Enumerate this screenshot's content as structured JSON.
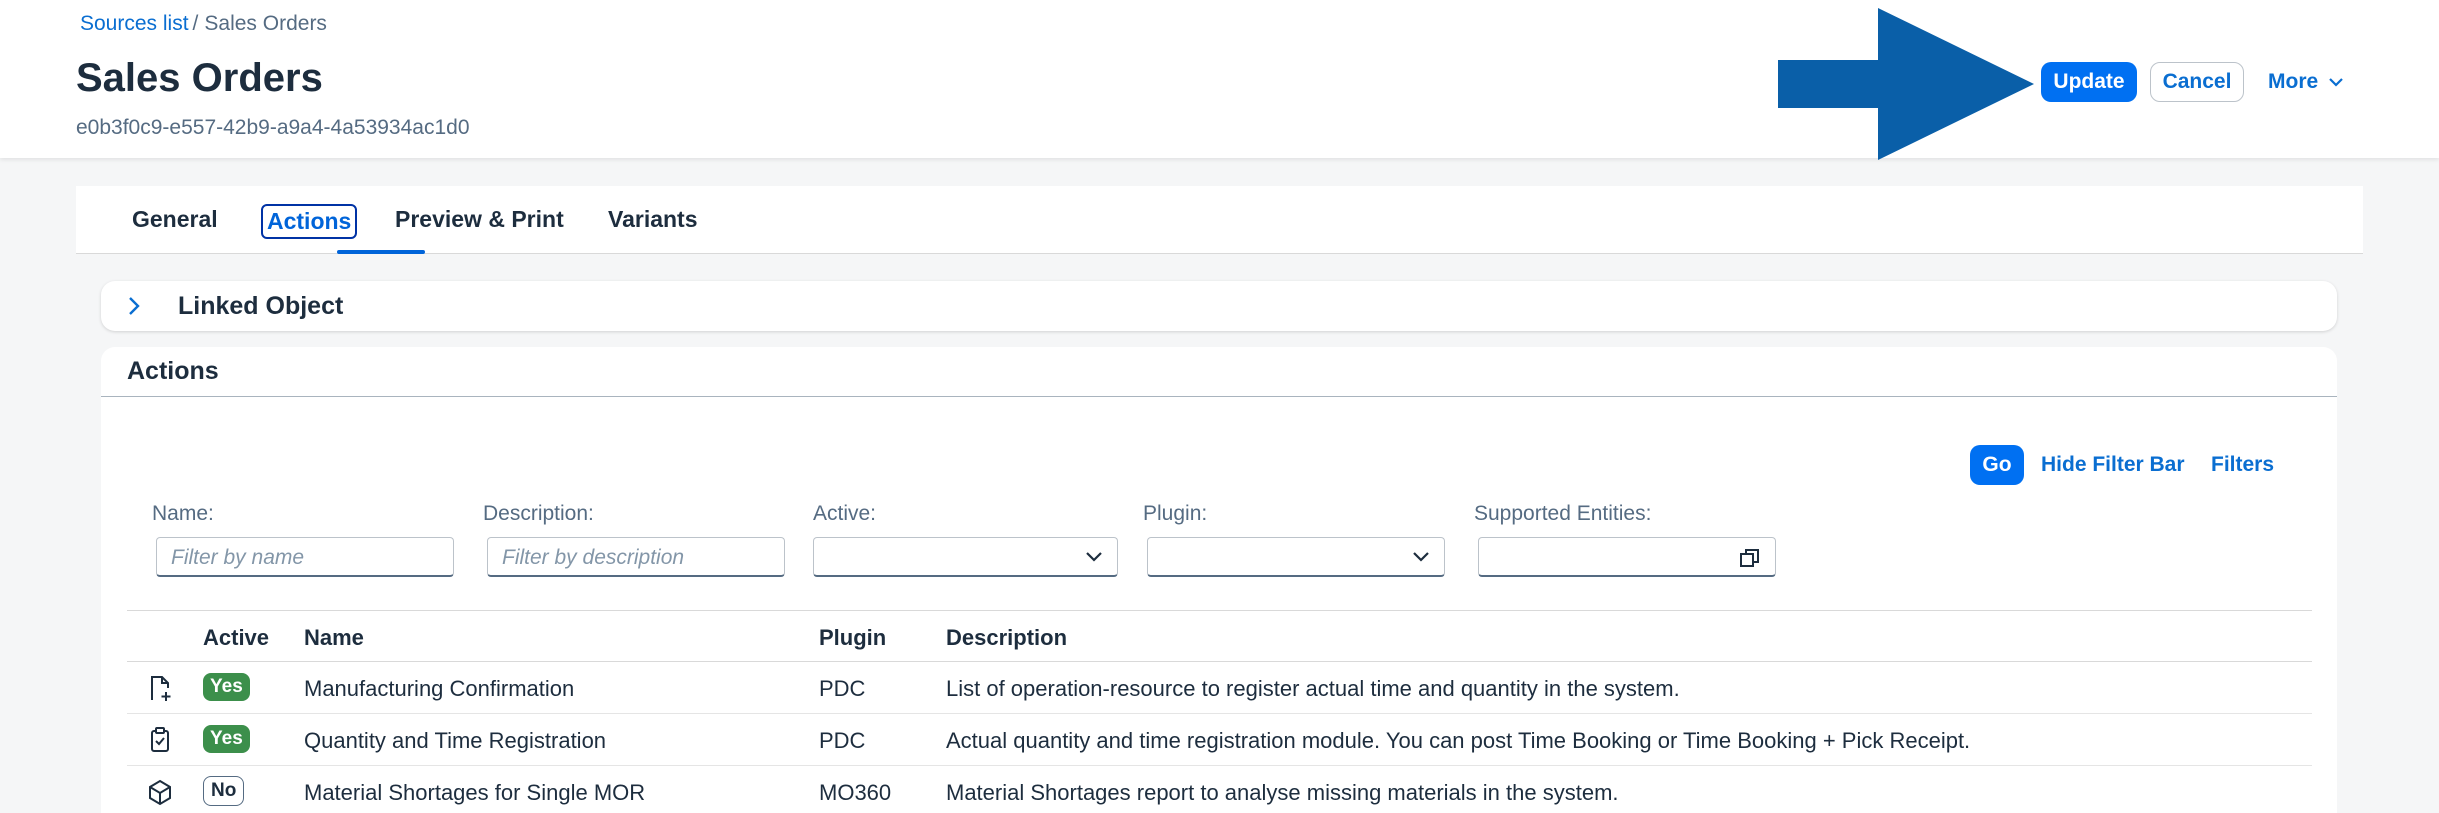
{
  "breadcrumb": {
    "link": "Sources list",
    "separator": "/",
    "current": "Sales Orders"
  },
  "header": {
    "title": "Sales Orders",
    "subtitle": "e0b3f0c9-e557-42b9-a9a4-4a53934ac1d0",
    "update_label": "Update",
    "cancel_label": "Cancel",
    "more_label": "More"
  },
  "tabs": [
    {
      "label": "General"
    },
    {
      "label": "Actions",
      "active": true
    },
    {
      "label": "Preview & Print"
    },
    {
      "label": "Variants"
    }
  ],
  "linked_object": {
    "label": "Linked Object"
  },
  "actions": {
    "title": "Actions",
    "go_label": "Go",
    "hide_filter_label": "Hide Filter Bar",
    "filters_label": "Filters",
    "filters": {
      "name_label": "Name:",
      "name_placeholder": "Filter by name",
      "description_label": "Description:",
      "description_placeholder": "Filter by description",
      "active_label": "Active:",
      "plugin_label": "Plugin:",
      "entities_label": "Supported Entities:"
    },
    "columns": {
      "active": "Active",
      "name": "Name",
      "plugin": "Plugin",
      "description": "Description"
    },
    "rows": [
      {
        "icon": "document-add-icon",
        "active": "Yes",
        "name": "Manufacturing Confirmation",
        "plugin": "PDC",
        "description": "List of operation-resource to register actual time and quantity in the system."
      },
      {
        "icon": "clipboard-check-icon",
        "active": "Yes",
        "name": "Quantity and Time Registration",
        "plugin": "PDC",
        "description": "Actual quantity and time registration module. You can post Time Booking or Time Booking + Pick Receipt."
      },
      {
        "icon": "cube-icon",
        "active": "No",
        "name": "Material Shortages for Single MOR",
        "plugin": "MO360",
        "description": "Material Shortages report to analyse missing materials in the system."
      }
    ]
  },
  "colors": {
    "accent": "#0070f2",
    "link": "#0a6ed1",
    "arrow": "#0a5fa8",
    "badge_yes": "#3c8f4b"
  }
}
